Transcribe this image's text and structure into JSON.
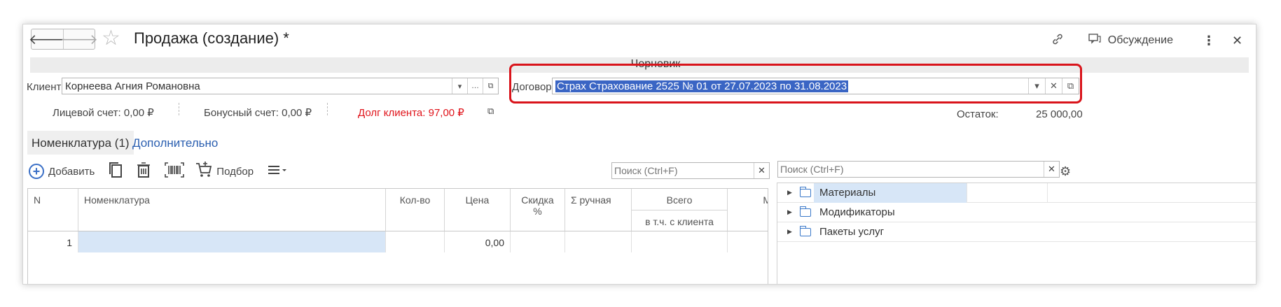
{
  "window": {
    "title": "Продажа (создание) *",
    "status": "Черновик",
    "discuss_label": "Обсуждение"
  },
  "nav": {
    "back": "🡐",
    "forward": "🡒"
  },
  "client": {
    "label": "Клиент:",
    "value": "Корнеева Агния Романовна",
    "account": "Лицевой счет: 0,00 ₽",
    "bonus": "Бонусный счет: 0,00 ₽",
    "debt": "Долг клиента: 97,00 ₽"
  },
  "contract": {
    "label": "Договор:",
    "value": "Страх Страхование 2525  № 01 от 27.07.2023 по 31.08.2023"
  },
  "balance": {
    "label": "Остаток:",
    "value": "25 000,00"
  },
  "tabs": [
    {
      "label": "Номенклатура (1)",
      "active": true
    },
    {
      "label": "Дополнительно",
      "active": false
    }
  ],
  "toolbar": {
    "add_label": "Добавить",
    "pick_label": "Подбор"
  },
  "search": {
    "placeholder": "Поиск (Ctrl+F)"
  },
  "tree_search": {
    "placeholder": "Поиск (Ctrl+F)"
  },
  "table": {
    "columns": {
      "n": "N",
      "item": "Номенклатура",
      "qty": "Кол-во",
      "price": "Цена",
      "discount": "Скидка %",
      "manual": "Σ ручная",
      "total": "Всего",
      "total_sub": "в т.ч. с клиента",
      "more": "М"
    },
    "rows": [
      {
        "n": "1",
        "item": "",
        "qty": "",
        "price": "0,00"
      }
    ]
  },
  "tree": {
    "items": [
      "Материалы",
      "Модификаторы",
      "Пакеты услуг"
    ]
  },
  "colors": {
    "accent": "#3a65c4",
    "debt": "#e0141b",
    "highlight": "#d9141b",
    "link": "#2b5fb0"
  }
}
